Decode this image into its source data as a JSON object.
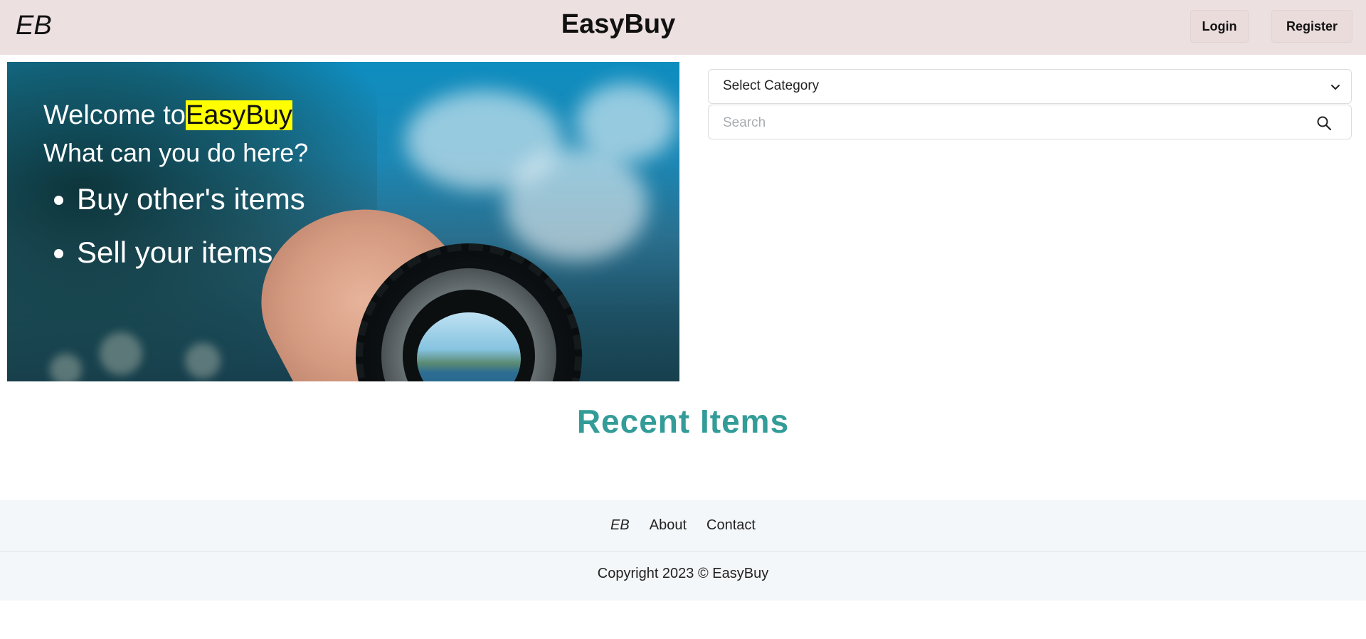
{
  "header": {
    "logo": "EB",
    "brand": "EasyBuy",
    "login_label": "Login",
    "register_label": "Register"
  },
  "hero": {
    "welcome_prefix": "Welcome to",
    "welcome_highlight": "EasyBuy",
    "question": "What can you do here?",
    "items": [
      "Buy other's items",
      "Sell your items"
    ]
  },
  "filters": {
    "category_selected": "Select Category",
    "search_placeholder": "Search",
    "search_value": ""
  },
  "recent": {
    "title": "Recent Items"
  },
  "footer": {
    "logo": "EB",
    "links": [
      "About",
      "Contact"
    ],
    "copyright": "Copyright 2023 © EasyBuy"
  },
  "colors": {
    "header_bg": "#ede0e0",
    "accent_teal": "#339c98",
    "highlight_yellow": "#ffff00",
    "footer_bg": "#f4f7f9"
  },
  "icons": {
    "select": "chevron-down-icon",
    "search": "search-icon"
  }
}
